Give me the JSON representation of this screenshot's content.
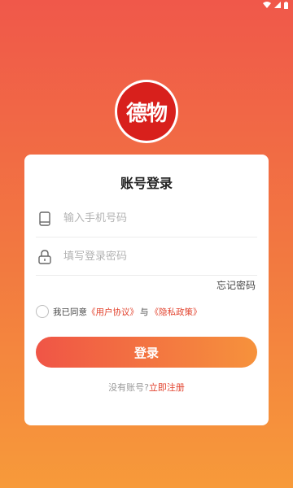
{
  "status_bar": {
    "icons": [
      "wifi-icon",
      "signal-icon",
      "battery-icon"
    ]
  },
  "logo": {
    "text": "德物",
    "background": "#d8201c"
  },
  "card": {
    "title": "账号登录",
    "phone_field": {
      "placeholder": "输入手机号码",
      "value": "",
      "icon": "phone-icon"
    },
    "code_field": {
      "placeholder": "填写登录密码",
      "value": "",
      "icon": "lock-icon"
    },
    "forgot_password": "忘记密码",
    "agreement": {
      "prefix": "我已同意",
      "user_agreement": "《用户协议》",
      "middle": "与",
      "privacy_policy": "《隐私政策》",
      "checked": false
    },
    "login_button": "登录",
    "register": {
      "prefix": "没有账号?",
      "link": "立即注册"
    }
  },
  "colors": {
    "accent": "#e2432e",
    "gradient_start": "#f05546",
    "gradient_end": "#f6923c"
  }
}
